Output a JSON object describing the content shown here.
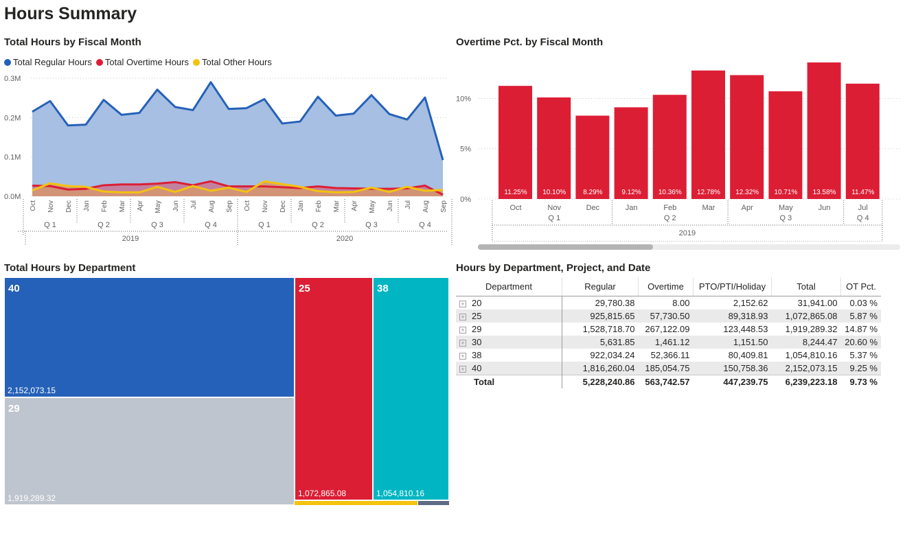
{
  "page": {
    "title": "Hours Summary"
  },
  "colors": {
    "regular": "#2561b8",
    "regular_fill": "#a6bfe2",
    "overtime": "#dc1e35",
    "other": "#f3c30f",
    "other_fill": "#d6966e",
    "gray": "#bfc5ce",
    "teal": "#01b6c2",
    "slate": "#5e6c87"
  },
  "line_chart": {
    "title": "Total Hours by Fiscal Month",
    "legend": [
      "Total Regular Hours",
      "Total Overtime Hours",
      "Total Other Hours"
    ]
  },
  "bar_chart": {
    "title": "Overtime Pct. by Fiscal Month"
  },
  "treemap": {
    "title": "Total Hours by Department",
    "tiles": [
      {
        "label": "40",
        "value": "2,152,073.15"
      },
      {
        "label": "29",
        "value": "1,919,289.32"
      },
      {
        "label": "25",
        "value": "1,072,865.08"
      },
      {
        "label": "38",
        "value": "1,054,810.16"
      }
    ]
  },
  "matrix": {
    "title": "Hours by Department, Project, and Date",
    "headers": [
      "Department",
      "Regular",
      "Overtime",
      "PTO/PTI/Holiday",
      "Total",
      "OT Pct."
    ],
    "rows": [
      [
        "20",
        "29,780.38",
        "8.00",
        "2,152.62",
        "31,941.00",
        "0.03 %"
      ],
      [
        "25",
        "925,815.65",
        "57,730.50",
        "89,318.93",
        "1,072,865.08",
        "5.87 %"
      ],
      [
        "29",
        "1,528,718.70",
        "267,122.09",
        "123,448.53",
        "1,919,289.32",
        "14.87 %"
      ],
      [
        "30",
        "5,631.85",
        "1,461.12",
        "1,151.50",
        "8,244.47",
        "20.60 %"
      ],
      [
        "38",
        "922,034.24",
        "52,366.11",
        "80,409.81",
        "1,054,810.16",
        "5.37 %"
      ],
      [
        "40",
        "1,816,260.04",
        "185,054.75",
        "150,758.36",
        "2,152,073.15",
        "9.25 %"
      ]
    ],
    "total": [
      "Total",
      "5,228,240.86",
      "563,742.57",
      "447,239.75",
      "6,239,223.18",
      "9.73 %"
    ]
  },
  "chart_data": [
    {
      "type": "area",
      "title": "Total Hours by Fiscal Month",
      "categories": [
        "Oct",
        "Nov",
        "Dec",
        "Jan",
        "Feb",
        "Mar",
        "Apr",
        "May",
        "Jun",
        "Jul",
        "Aug",
        "Sep",
        "Oct",
        "Nov",
        "Dec",
        "Jan",
        "Feb",
        "Mar",
        "Apr",
        "May",
        "Jun",
        "Jul",
        "Aug",
        "Sep"
      ],
      "quarters": [
        {
          "label": "Q 1",
          "span": 3
        },
        {
          "label": "Q 2",
          "span": 3
        },
        {
          "label": "Q 3",
          "span": 3
        },
        {
          "label": "Q 4",
          "span": 3
        },
        {
          "label": "Q 1",
          "span": 3
        },
        {
          "label": "Q 2",
          "span": 3
        },
        {
          "label": "Q 3",
          "span": 3
        },
        {
          "label": "Q 4",
          "span": 3
        }
      ],
      "years": [
        {
          "label": "2019",
          "span": 12
        },
        {
          "label": "2020",
          "span": 12
        }
      ],
      "y_ticks": [
        {
          "value": 0,
          "label": "0.0M"
        },
        {
          "value": 100000,
          "label": "0.1M"
        },
        {
          "value": 200000,
          "label": "0.2M"
        },
        {
          "value": 300000,
          "label": "0.3M"
        }
      ],
      "ylim": [
        0,
        300000
      ],
      "series": [
        {
          "name": "Total Regular Hours",
          "values": [
            215000,
            242000,
            180000,
            182000,
            245000,
            207000,
            212000,
            271000,
            227000,
            219000,
            290000,
            222000,
            224000,
            247000,
            185000,
            190000,
            253000,
            205000,
            210000,
            257000,
            209000,
            195000,
            251000,
            92000
          ]
        },
        {
          "name": "Total Overtime Hours",
          "values": [
            27000,
            26000,
            17000,
            19000,
            28000,
            30000,
            30000,
            32000,
            36000,
            28000,
            38000,
            25000,
            25000,
            25000,
            23000,
            21000,
            25000,
            21000,
            20000,
            19000,
            19000,
            20000,
            27000,
            4000
          ]
        },
        {
          "name": "Total Other Hours",
          "values": [
            15000,
            33000,
            26000,
            24000,
            12000,
            10000,
            10000,
            24000,
            11000,
            26000,
            14000,
            22000,
            11000,
            38000,
            31000,
            24000,
            13000,
            10000,
            11000,
            22000,
            11000,
            24000,
            14000,
            16000
          ]
        }
      ],
      "grid": true,
      "legend": "top-left"
    },
    {
      "type": "bar",
      "title": "Overtime Pct. by Fiscal Month",
      "categories": [
        "Oct",
        "Nov",
        "Dec",
        "Jan",
        "Feb",
        "Mar",
        "Apr",
        "May",
        "Jun",
        "Jul"
      ],
      "quarters": [
        {
          "label": "Q 1",
          "span": 3
        },
        {
          "label": "Q 2",
          "span": 3
        },
        {
          "label": "Q 3",
          "span": 3
        },
        {
          "label": "Q 4",
          "span": 1
        }
      ],
      "years": [
        {
          "label": "2019",
          "span": 10
        }
      ],
      "values": [
        11.25,
        10.1,
        8.29,
        9.12,
        10.36,
        12.78,
        12.32,
        10.71,
        13.58,
        11.47
      ],
      "data_labels": [
        "11.25%",
        "10.10%",
        "8.29%",
        "9.12%",
        "10.36%",
        "12.78%",
        "12.32%",
        "10.71%",
        "13.58%",
        "11.47%"
      ],
      "y_ticks": [
        {
          "value": 0,
          "label": "0%"
        },
        {
          "value": 5,
          "label": "5%"
        },
        {
          "value": 10,
          "label": "10%"
        }
      ],
      "ylim": [
        0,
        13.58
      ],
      "grid": true
    }
  ]
}
